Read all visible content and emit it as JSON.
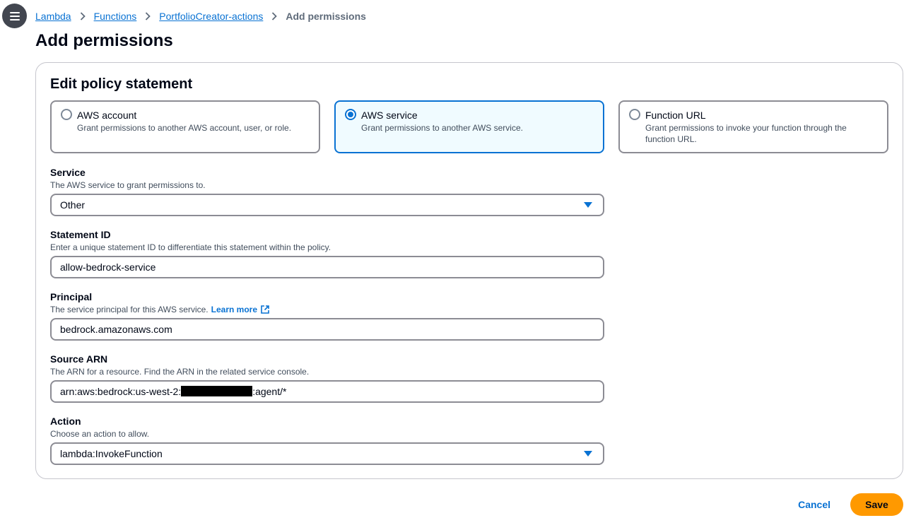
{
  "menu": {
    "icon": "menu-icon"
  },
  "breadcrumb": {
    "items": [
      {
        "label": "Lambda"
      },
      {
        "label": "Functions"
      },
      {
        "label": "PortfolioCreator-actions"
      }
    ],
    "current": "Add permissions"
  },
  "page": {
    "title": "Add permissions"
  },
  "panel": {
    "title": "Edit policy statement",
    "options": [
      {
        "label": "AWS account",
        "description": "Grant permissions to another AWS account, user, or role.",
        "selected": false
      },
      {
        "label": "AWS service",
        "description": "Grant permissions to another AWS service.",
        "selected": true
      },
      {
        "label": "Function URL",
        "description": "Grant permissions to invoke your function through the function URL.",
        "selected": false
      }
    ],
    "service": {
      "label": "Service",
      "description": "The AWS service to grant permissions to.",
      "value": "Other"
    },
    "statement_id": {
      "label": "Statement ID",
      "description": "Enter a unique statement ID to differentiate this statement within the policy.",
      "value": "allow-bedrock-service"
    },
    "principal": {
      "label": "Principal",
      "description": "The service principal for this AWS service.",
      "learn_more": "Learn more",
      "value": "bedrock.amazonaws.com"
    },
    "source_arn": {
      "label": "Source ARN",
      "description": "The ARN for a resource. Find the ARN in the related service console.",
      "value_prefix": "arn:aws:bedrock:us-west-2:",
      "value_suffix": ":agent/*"
    },
    "action": {
      "label": "Action",
      "description": "Choose an action to allow.",
      "value": "lambda:InvokeFunction"
    }
  },
  "footer": {
    "cancel_label": "Cancel",
    "save_label": "Save"
  },
  "colors": {
    "link": "#0972d3",
    "primary_button": "#ff9900",
    "selected_tile_bg": "#f0fbff"
  }
}
